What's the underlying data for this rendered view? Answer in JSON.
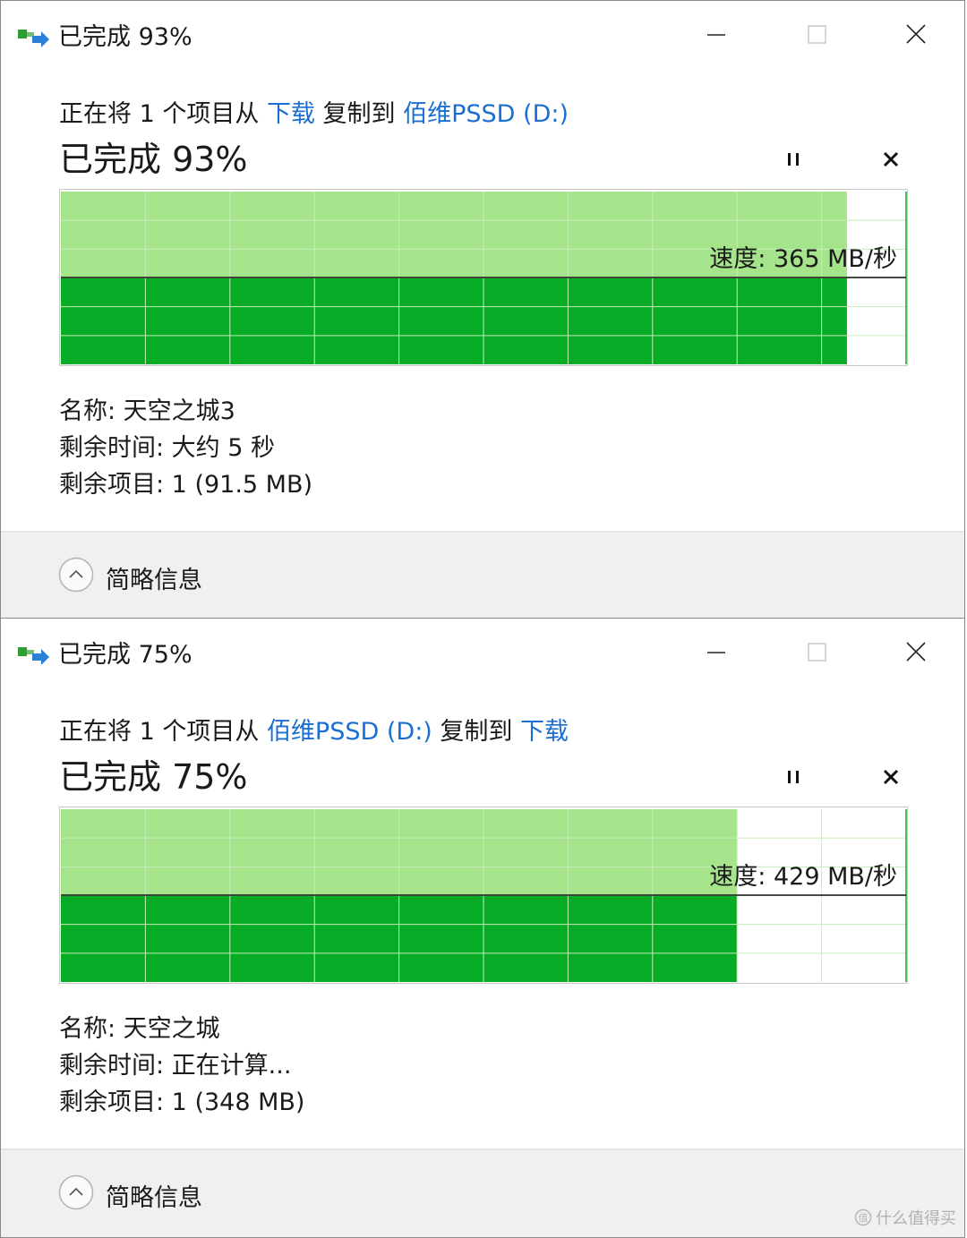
{
  "colors": {
    "link": "#1a6fd1",
    "graph_fill": "#06ab26",
    "graph_light": "#a6e48c",
    "grid": "#c6ecb8"
  },
  "dialogs": [
    {
      "window_title": "已完成 93%",
      "copy_prefix": "正在将 1 个项目从 ",
      "copy_source": "下载",
      "copy_mid": " 复制到 ",
      "copy_dest": "佰维PSSD (D:)",
      "big_title": "已完成 93%",
      "progress": 0.93,
      "speed": "速度: 365 MB/秒",
      "name": "名称: 天空之城3",
      "time_remaining": "剩余时间: 大约 5 秒",
      "items_remaining": "剩余项目: 1 (91.5 MB)",
      "footer_label": "简略信息",
      "icons": {
        "app": "copy-transfer-icon",
        "minimize": "minimize-icon",
        "maximize": "maximize-icon",
        "close": "close-icon",
        "pause": "pause-icon",
        "cancel": "cancel-icon",
        "collapse": "chevron-up-icon"
      }
    },
    {
      "window_title": "已完成 75%",
      "copy_prefix": "正在将 1 个项目从 ",
      "copy_source": "佰维PSSD (D:)",
      "copy_mid": " 复制到 ",
      "copy_dest": "下载",
      "big_title": "已完成 75%",
      "progress": 0.8,
      "speed": "速度: 429 MB/秒",
      "name": "名称: 天空之城",
      "time_remaining": "剩余时间: 正在计算...",
      "items_remaining": "剩余项目: 1 (348 MB)",
      "footer_label": "简略信息",
      "icons": {
        "app": "copy-transfer-icon",
        "minimize": "minimize-icon",
        "maximize": "maximize-icon",
        "close": "close-icon",
        "pause": "pause-icon",
        "cancel": "cancel-icon",
        "collapse": "chevron-up-icon"
      }
    }
  ],
  "watermark": "什么值得买"
}
